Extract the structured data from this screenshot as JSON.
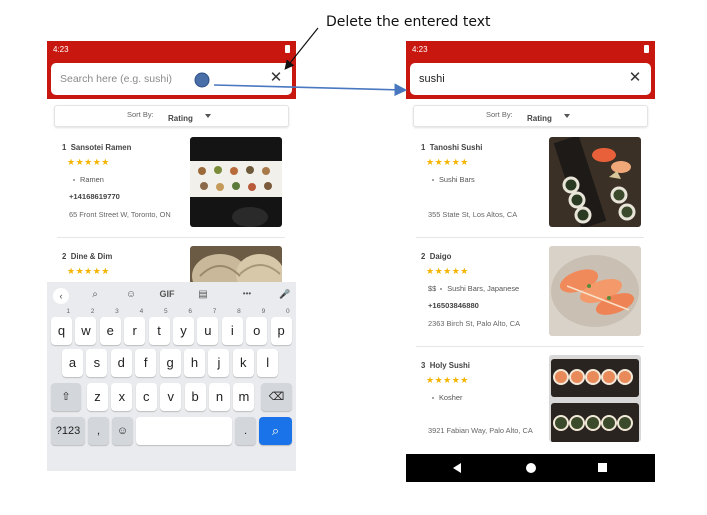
{
  "annotation": {
    "text": "Delete the entered text"
  },
  "left_screen": {
    "status_time": "4:23",
    "search": {
      "placeholder": "Search here (e.g. sushi)",
      "value": ""
    },
    "sort": {
      "label": "Sort By:",
      "value": "Rating"
    },
    "results": [
      {
        "rank": "1",
        "name": "Sansotei Ramen",
        "stars": "★★★★★",
        "rating": 4.5,
        "category": "Ramen",
        "phone": "+14168619770",
        "address": "65 Front Street W, Toronto, ON",
        "photo": "bento-display-photo"
      },
      {
        "rank": "2",
        "name": "Dine & Dim",
        "stars": "★★★★★",
        "rating": 4.5,
        "photo": "dumpling-basket-photo"
      }
    ],
    "keyboard": {
      "toolbar": [
        "‹",
        "⌕",
        "☺",
        "GIF",
        "▤",
        "•••",
        "🎤"
      ],
      "row1": [
        {
          "k": "q",
          "n": "1"
        },
        {
          "k": "w",
          "n": "2"
        },
        {
          "k": "e",
          "n": "3"
        },
        {
          "k": "r",
          "n": "4"
        },
        {
          "k": "t",
          "n": "5"
        },
        {
          "k": "y",
          "n": "6"
        },
        {
          "k": "u",
          "n": "7"
        },
        {
          "k": "i",
          "n": "8"
        },
        {
          "k": "o",
          "n": "9"
        },
        {
          "k": "p",
          "n": "0"
        }
      ],
      "row2": [
        "a",
        "s",
        "d",
        "f",
        "g",
        "h",
        "j",
        "k",
        "l"
      ],
      "row3": [
        "z",
        "x",
        "c",
        "v",
        "b",
        "n",
        "m"
      ],
      "shift": "⇧",
      "backspace": "⌫",
      "symbols": "?123",
      "comma": ",",
      "emoji": "☺",
      "period": ".",
      "search": "⌕"
    }
  },
  "right_screen": {
    "status_time": "4:23",
    "search": {
      "value": "sushi"
    },
    "sort": {
      "label": "Sort By:",
      "value": "Rating"
    },
    "results": [
      {
        "rank": "1",
        "name": "Tanoshi Sushi",
        "stars": "★★★★★",
        "rating": 5,
        "category": "Sushi Bars",
        "address": "355 State St, Los Altos, CA",
        "photo": "sushi-rolls-photo"
      },
      {
        "rank": "2",
        "name": "Daigo",
        "stars": "★★★★★",
        "rating": 4.5,
        "price": "$$",
        "category": "Sushi Bars, Japanese",
        "phone": "+16503846880",
        "address": "2363 Birch St, Palo Alto, CA",
        "photo": "salmon-sashimi-photo"
      },
      {
        "rank": "3",
        "name": "Holy Sushi",
        "stars": "★★★★★",
        "rating": 4.5,
        "category": "Kosher",
        "address": "3921 Fabian Way, Palo Alto, CA",
        "photo": "sushi-tray-photo"
      }
    ]
  }
}
